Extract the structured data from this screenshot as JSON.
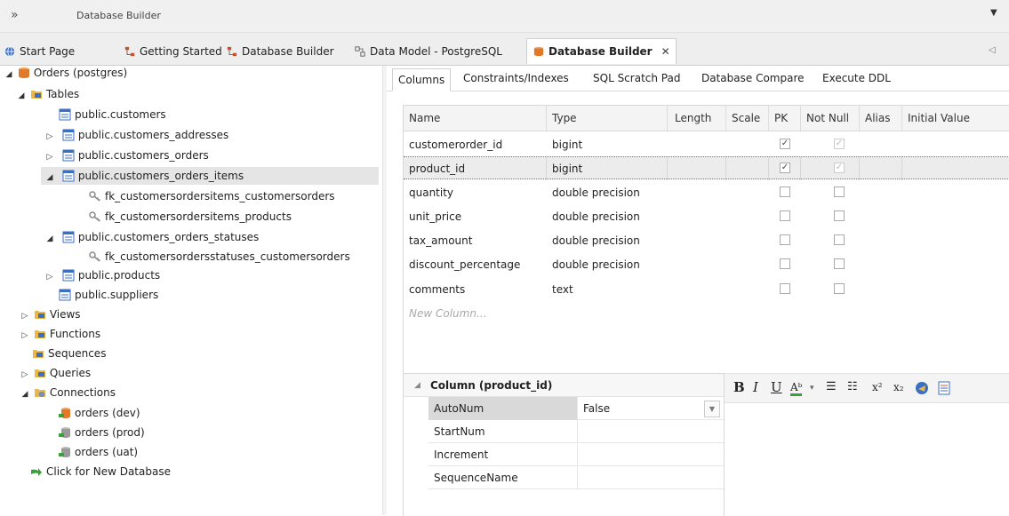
{
  "window": {
    "title": "Database Builder"
  },
  "tabs": [
    {
      "label": "Start Page",
      "icon": "globe-icon"
    },
    {
      "label": "Getting Started",
      "icon": "diagram-icon"
    },
    {
      "label": "Database Builder",
      "icon": "diagram-icon"
    },
    {
      "label": "Data Model - PostgreSQL",
      "icon": "model-icon"
    },
    {
      "label": "Database Builder",
      "icon": "database-icon",
      "active": true
    }
  ],
  "tree": {
    "root": "Orders (postgres)",
    "tables_label": "Tables",
    "tables": [
      "public.customers",
      "public.customers_addresses",
      "public.customers_orders",
      "public.customers_orders_items",
      "fk_customersordersitems_customersorders",
      "fk_customersordersitems_products",
      "public.customers_orders_statuses",
      "fk_customersordersstatuses_customersorders",
      "public.products",
      "public.suppliers"
    ],
    "views": "Views",
    "functions": "Functions",
    "sequences": "Sequences",
    "queries": "Queries",
    "connections_label": "Connections",
    "connections": [
      "orders (dev)",
      "orders (prod)",
      "orders (uat)"
    ],
    "new_db": "Click for New Database"
  },
  "subtabs": [
    "Columns",
    "Constraints/Indexes",
    "SQL Scratch Pad",
    "Database Compare",
    "Execute DDL"
  ],
  "grid": {
    "headers": [
      "Name",
      "Type",
      "Length",
      "Scale",
      "PK",
      "Not Null",
      "Alias",
      "Initial Value"
    ],
    "rows": [
      {
        "name": "customerorder_id",
        "type": "bigint"
      },
      {
        "name": "product_id",
        "type": "bigint"
      },
      {
        "name": "quantity",
        "type": "double precision"
      },
      {
        "name": "unit_price",
        "type": "double precision"
      },
      {
        "name": "tax_amount",
        "type": "double precision"
      },
      {
        "name": "discount_percentage",
        "type": "double precision"
      },
      {
        "name": "comments",
        "type": "text"
      }
    ],
    "new_column": "New Column..."
  },
  "props": {
    "title": "Column (product_id)",
    "rows": [
      {
        "key": "AutoNum",
        "value": "False"
      },
      {
        "key": "StartNum",
        "value": ""
      },
      {
        "key": "Increment",
        "value": ""
      },
      {
        "key": "SequenceName",
        "value": ""
      }
    ]
  },
  "editor_toolbar": [
    "bold-icon",
    "italic-icon",
    "underline-icon",
    "font-color-icon",
    "bullet-list-icon",
    "numbered-list-icon",
    "superscript-icon",
    "subscript-icon",
    "hyperlink-icon",
    "document-icon"
  ],
  "colors": {
    "table_icon": "#3b6fc4",
    "folder_icon": "#e8b84a",
    "database_icon": "#e07a2a",
    "arrow_green": "#3aa13a",
    "key_icon": "#9a9a9a"
  }
}
